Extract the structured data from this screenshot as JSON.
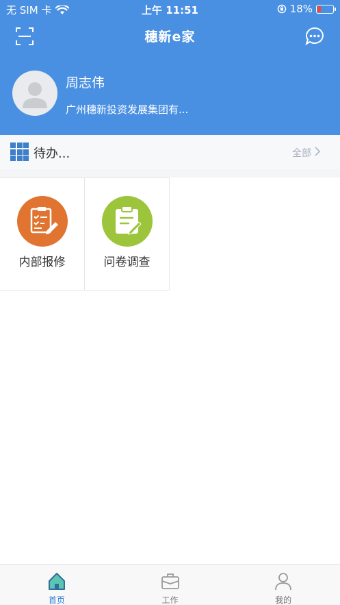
{
  "status_bar": {
    "carrier": "无 SIM 卡",
    "time": "上午 11:51",
    "battery": "18%"
  },
  "header": {
    "title": "穗新e家"
  },
  "profile": {
    "name": "周志伟",
    "organization": "广州穗新投资发展集团有..."
  },
  "todo": {
    "title": "待办...",
    "all_label": "全部"
  },
  "grid": [
    {
      "label": "内部报修",
      "color": "#e07430",
      "icon": "repair-list-icon"
    },
    {
      "label": "问卷调查",
      "color": "#9cc53c",
      "icon": "survey-clipboard-icon"
    }
  ],
  "tabs": [
    {
      "label": "首页",
      "icon": "home-icon",
      "active": true
    },
    {
      "label": "工作",
      "icon": "briefcase-icon",
      "active": false
    },
    {
      "label": "我的",
      "icon": "person-icon",
      "active": false
    }
  ],
  "colors": {
    "header_blue": "#4a90e2",
    "active_tab": "#2f7fd1"
  }
}
